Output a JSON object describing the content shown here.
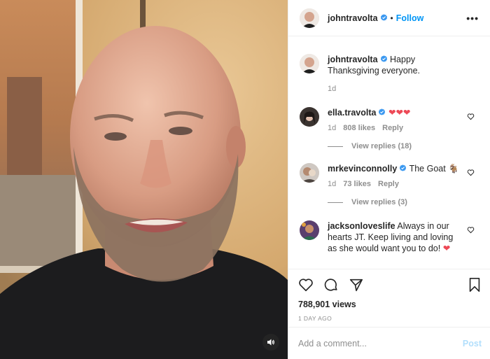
{
  "header": {
    "username": "johntravolta",
    "separator": "•",
    "follow_label": "Follow",
    "more_label": "•••"
  },
  "caption": {
    "username": "johntravolta",
    "text": "Happy Thanksgiving everyone.",
    "time": "1d"
  },
  "comments": [
    {
      "username": "ella.travolta",
      "text": "❤❤❤",
      "time": "1d",
      "likes": "808 likes",
      "reply_label": "Reply",
      "view_replies": "View replies (18)"
    },
    {
      "username": "mrkevinconnolly",
      "text": "The Goat 🐐",
      "time": "1d",
      "likes": "73 likes",
      "reply_label": "Reply",
      "view_replies": "View replies (3)"
    },
    {
      "username": "jacksonloveslife",
      "text": "Always in our hearts JT. Keep living and loving as she would want you to do! ",
      "emoji": "❤"
    }
  ],
  "stats": {
    "views": "788,901 views",
    "time_ago": "1 DAY AGO"
  },
  "add_comment": {
    "placeholder": "Add a comment...",
    "post_label": "Post"
  },
  "icons": {
    "like": "heart-icon",
    "comment": "comment-icon",
    "share": "share-icon",
    "save": "bookmark-icon",
    "mute": "speaker-icon",
    "verified": "verified-badge-icon"
  },
  "colors": {
    "link_blue": "#0095f6",
    "verified_blue": "#3897f0",
    "heart_red": "#ed4956",
    "muted_text": "#8e8e8e",
    "post_disabled": "#b2dffc"
  }
}
